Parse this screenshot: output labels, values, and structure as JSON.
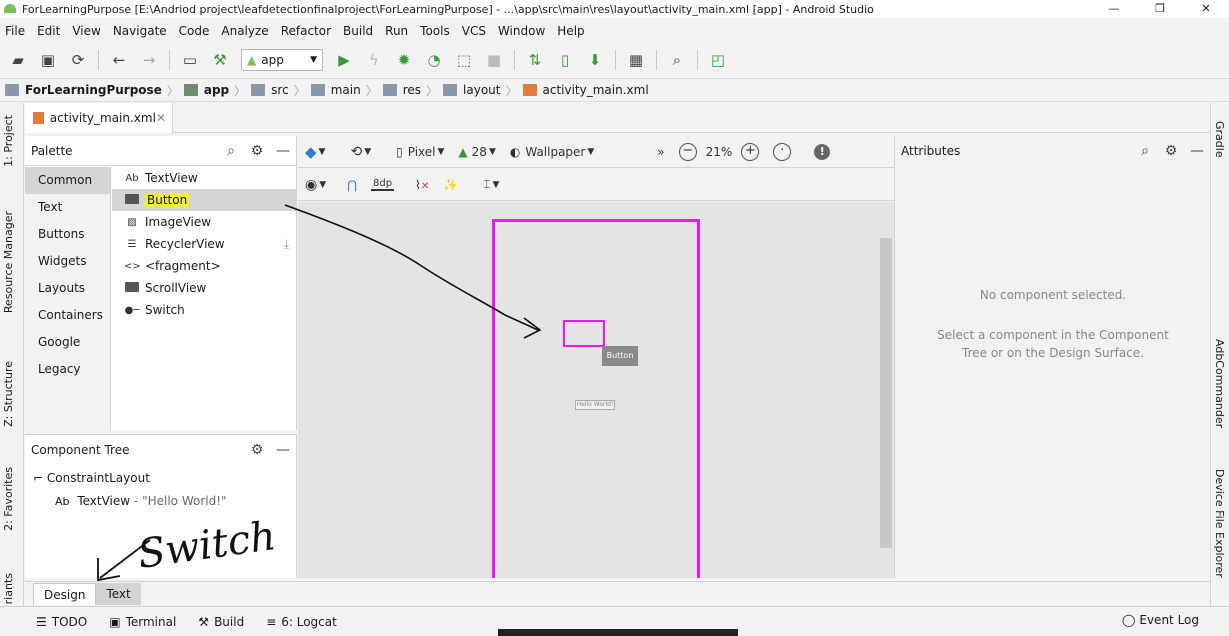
{
  "window": {
    "title": "ForLearningPurpose [E:\\Andriod project\\leafdetectionfinalproject\\ForLearningPurpose] - ...\\app\\src\\main\\res\\layout\\activity_main.xml [app] - Android Studio",
    "minimize": "—",
    "maximize": "❐",
    "close": "✕"
  },
  "menu": [
    "File",
    "Edit",
    "View",
    "Navigate",
    "Code",
    "Analyze",
    "Refactor",
    "Build",
    "Run",
    "Tools",
    "VCS",
    "Window",
    "Help"
  ],
  "toolbar": {
    "run_config": "app"
  },
  "breadcrumb": [
    "ForLearningPurpose",
    "app",
    "src",
    "main",
    "res",
    "layout",
    "activity_main.xml"
  ],
  "left_tool_tabs": [
    "1: Project",
    "Resource Manager",
    "Z: Structure",
    "2: Favorites",
    "riants"
  ],
  "right_tool_tabs": [
    "Gradle",
    "AdbCommander",
    "Device File Explorer"
  ],
  "editor_tab": {
    "label": "activity_main.xml",
    "close": "✕"
  },
  "palette": {
    "title": "Palette",
    "categories": [
      "Common",
      "Text",
      "Buttons",
      "Widgets",
      "Layouts",
      "Containers",
      "Google",
      "Legacy"
    ],
    "selected_category": "Common",
    "items": [
      {
        "icon": "Ab",
        "label": "TextView"
      },
      {
        "icon": "btn",
        "label": "Button"
      },
      {
        "icon": "img",
        "label": "ImageView"
      },
      {
        "icon": "list",
        "label": "RecyclerView"
      },
      {
        "icon": "<>",
        "label": "<fragment>"
      },
      {
        "icon": "btn",
        "label": "ScrollView"
      },
      {
        "icon": "sw",
        "label": "Switch"
      }
    ]
  },
  "component_tree": {
    "title": "Component Tree",
    "root": "ConstraintLayout",
    "child_icon": "Ab",
    "child": "TextView",
    "child_detail": "- \"Hello World!\""
  },
  "design_toolbar": {
    "device": "Pixel",
    "api": "28",
    "theme": "Wallpaper",
    "more": "»",
    "zoom": "21%",
    "margin": "8dp"
  },
  "canvas": {
    "ghost_label": "Button",
    "textview_label": "Hello World!",
    "frame_color": "#f018f0"
  },
  "attributes": {
    "title": "Attributes",
    "empty_message": "No component selected.",
    "hint_line1": "Select a component in the Component",
    "hint_line2": "Tree or on the Design Surface."
  },
  "design_tabs": [
    "Design",
    "Text"
  ],
  "statusbar": [
    "TODO",
    "Terminal",
    "Build",
    "6: Logcat"
  ],
  "statusbar_right": "Event Log",
  "annotation": {
    "text": "Switch"
  }
}
